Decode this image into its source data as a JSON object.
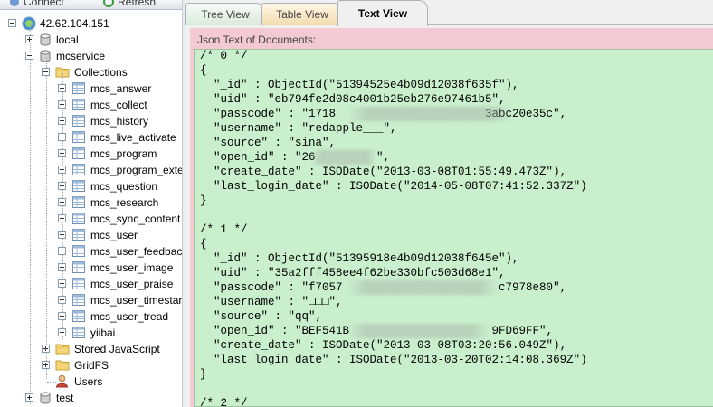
{
  "toolbar": {
    "connect_label": "Connect",
    "refresh_label": "Refresh"
  },
  "tree": {
    "server": "42.62.104.151",
    "databases": {
      "local": "local",
      "mcservice": "mcservice",
      "test": "test"
    },
    "collections_label": "Collections",
    "collections": [
      "mcs_answer",
      "mcs_collect",
      "mcs_history",
      "mcs_live_activate",
      "mcs_program",
      "mcs_program_exte",
      "mcs_question",
      "mcs_research",
      "mcs_sync_content",
      "mcs_user",
      "mcs_user_feedback",
      "mcs_user_image",
      "mcs_user_praise",
      "mcs_user_timestar",
      "mcs_user_tread",
      "yiibai"
    ],
    "stored_js_label": "Stored JavaScript",
    "gridfs_label": "GridFS",
    "users_label": "Users"
  },
  "tabs": {
    "tree_view": "Tree View",
    "table_view": "Table View",
    "text_view": "Text View"
  },
  "panel": {
    "label": "Json Text of Documents:"
  },
  "code_lines": [
    "/* 0 */",
    "{",
    "  \"_id\" : ObjectId(\"51394525e4b09d12038f635f\"),",
    "  \"uid\" : \"eb794fe2d08c4001b25eb276e97461b5\",",
    "  \"passcode\" : \"1718                      3abc20e35c\",",
    "  \"username\" : \"redapple___\",",
    "  \"source\" : \"sina\",",
    "  \"open_id\" : \"26         \",",
    "  \"create_date\" : ISODate(\"2013-03-08T01:55:49.473Z\"),",
    "  \"last_login_date\" : ISODate(\"2014-05-08T07:41:52.337Z\")",
    "}",
    "",
    "/* 1 */",
    "{",
    "  \"_id\" : ObjectId(\"51395918e4b09d12038f645e\"),",
    "  \"uid\" : \"35a2fff458ee4f62be330bfc503d68e1\",",
    "  \"passcode\" : \"f7057                       c7978e80\",",
    "  \"username\" : \"□□□\",",
    "  \"source\" : \"qq\",",
    "  \"open_id\" : \"BEF541B                     9FD69FF\",",
    "  \"create_date\" : ISODate(\"2013-03-08T03:20:56.049Z\"),",
    "  \"last_login_date\" : ISODate(\"2013-03-20T02:14:08.369Z\")",
    "}",
    "",
    "/* 2 */"
  ],
  "colors": {
    "panel_pink": "#f3c9d3",
    "code_green": "#c9efcc",
    "tab_tree": "#d9eadb",
    "tab_table": "#f3dcae",
    "folder_yellow": "#f5d67a"
  }
}
